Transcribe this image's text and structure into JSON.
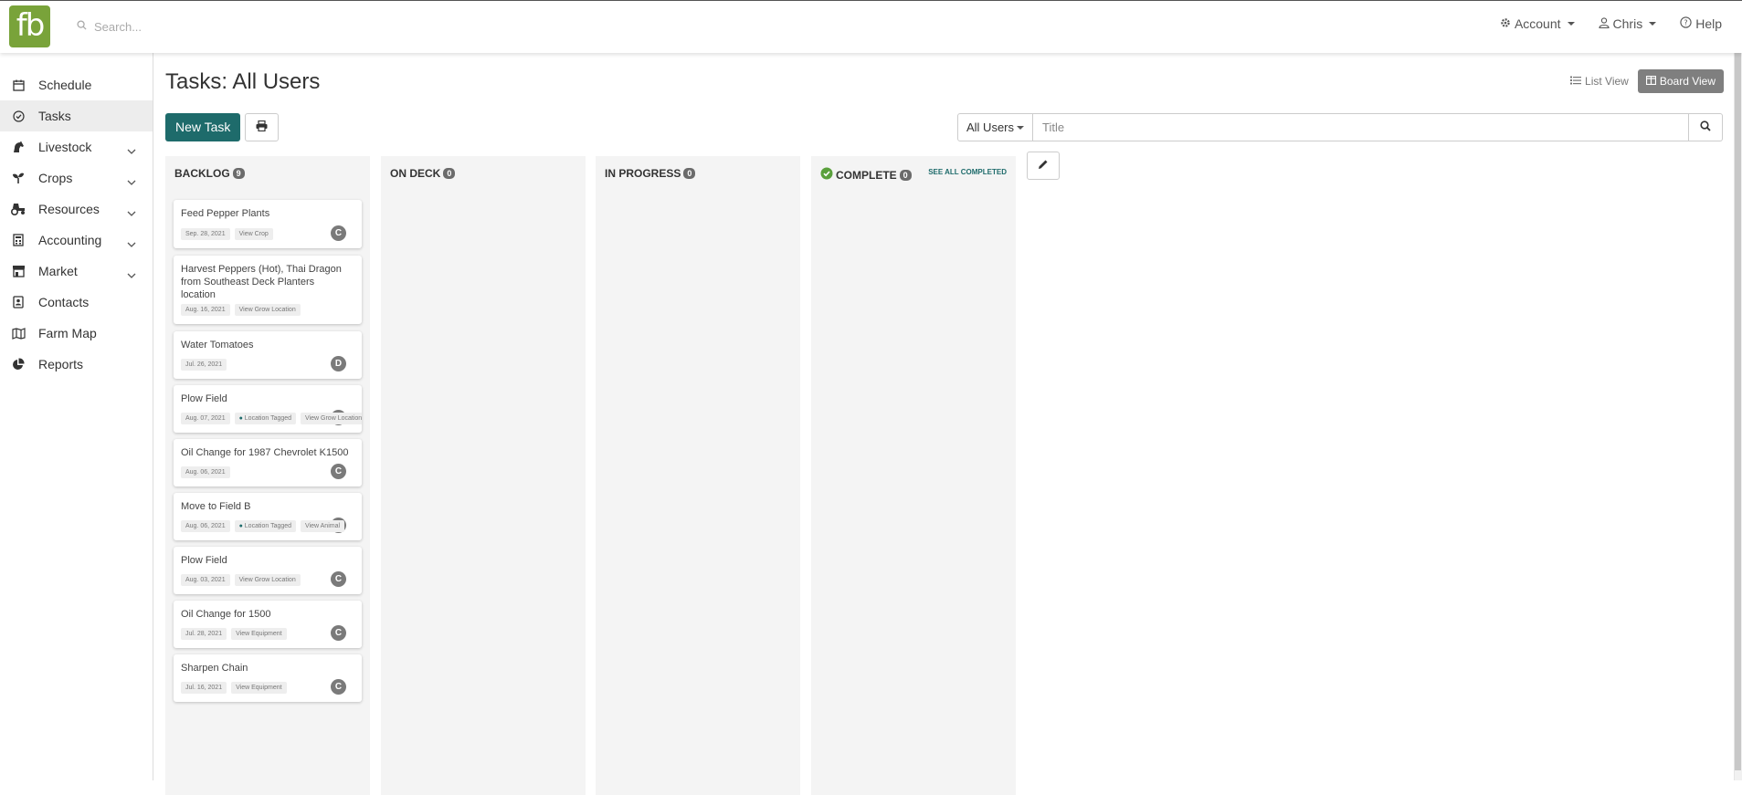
{
  "app": {
    "logo_text": "fb",
    "brand_color": "#79a33a",
    "accent_color": "#1e6b6b"
  },
  "search": {
    "placeholder": "Search..."
  },
  "topnav": {
    "account": "Account",
    "user": "Chris",
    "help": "Help"
  },
  "sidebar": {
    "items": [
      {
        "label": "Schedule",
        "icon": "calendar-icon",
        "expandable": false
      },
      {
        "label": "Tasks",
        "icon": "check-circle-icon",
        "expandable": false,
        "active": true
      },
      {
        "label": "Livestock",
        "icon": "horse-icon",
        "expandable": true
      },
      {
        "label": "Crops",
        "icon": "seedling-icon",
        "expandable": true
      },
      {
        "label": "Resources",
        "icon": "tractor-icon",
        "expandable": true
      },
      {
        "label": "Accounting",
        "icon": "calculator-icon",
        "expandable": true
      },
      {
        "label": "Market",
        "icon": "store-icon",
        "expandable": true
      },
      {
        "label": "Contacts",
        "icon": "address-book-icon",
        "expandable": false
      },
      {
        "label": "Farm Map",
        "icon": "map-icon",
        "expandable": false
      },
      {
        "label": "Reports",
        "icon": "pie-chart-icon",
        "expandable": false
      }
    ]
  },
  "page": {
    "title": "Tasks: All Users",
    "list_view": "List View",
    "board_view": "Board View",
    "new_task": "New Task",
    "filter_user": "All Users",
    "title_placeholder": "Title"
  },
  "columns": [
    {
      "name": "BACKLOG",
      "count": "9"
    },
    {
      "name": "ON DECK",
      "count": "0"
    },
    {
      "name": "IN PROGRESS",
      "count": "0"
    },
    {
      "name": "COMPLETE",
      "count": "0",
      "see_all": "SEE ALL COMPLETED"
    }
  ],
  "cards": [
    {
      "title": "Feed Pepper Plants",
      "date": "Sep. 28, 2021",
      "link": "View Crop",
      "avatar": "C"
    },
    {
      "title": "Harvest Peppers (Hot), Thai Dragon from Southeast Deck Planters location",
      "date": "Aug. 16, 2021",
      "link": "View Grow Location",
      "avatar": ""
    },
    {
      "title": "Water Tomatoes",
      "date": "Jul. 26, 2021",
      "avatar": "D"
    },
    {
      "title": "Plow Field",
      "date": "Aug. 07, 2021",
      "location": "Location Tagged",
      "link": "View Grow Location",
      "avatar": "C"
    },
    {
      "title": "Oil Change for 1987 Chevrolet K1500",
      "date": "Aug. 06, 2021",
      "avatar": "C"
    },
    {
      "title": "Move to Field B",
      "date": "Aug. 06, 2021",
      "location": "Location Tagged",
      "link": "View Animal",
      "avatar": "C"
    },
    {
      "title": "Plow Field",
      "date": "Aug. 03, 2021",
      "link": "View Grow Location",
      "avatar": "C"
    },
    {
      "title": "Oil Change for 1500",
      "date": "Jul. 28, 2021",
      "link": "View Equipment",
      "avatar": "C"
    },
    {
      "title": "Sharpen Chain",
      "date": "Jul. 16, 2021",
      "link": "View Equipment",
      "avatar": "C"
    }
  ]
}
